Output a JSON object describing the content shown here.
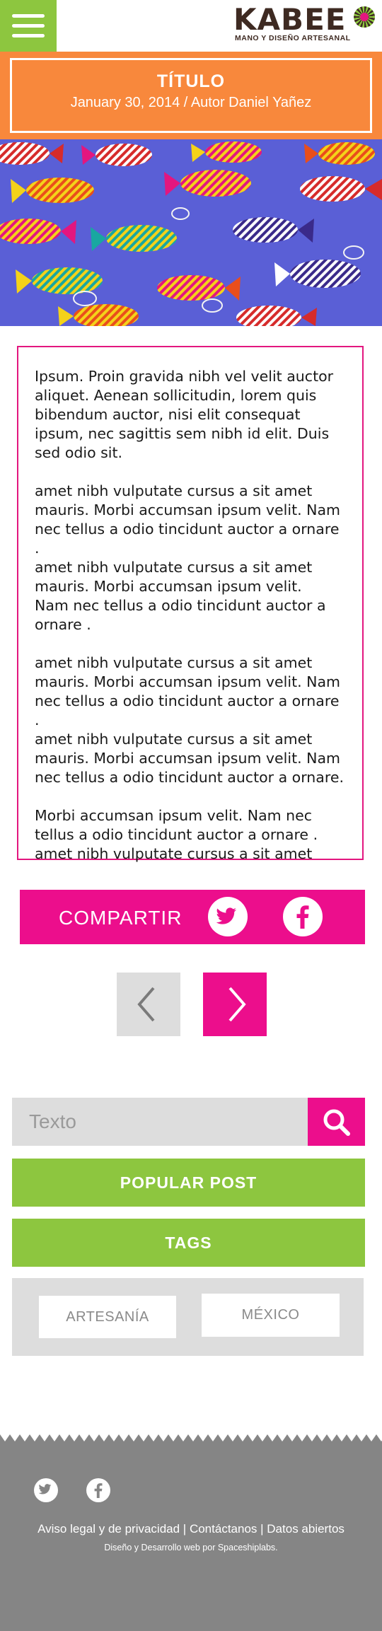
{
  "header": {
    "logo_text": "KABEE",
    "logo_tagline": "MANO Y DISEÑO ARTESANAL"
  },
  "post": {
    "title": "TÍTULO",
    "date": "January 30, 2014",
    "author": " / Autor Daniel Yañez",
    "paragraphs": [
      "Ipsum. Proin gravida nibh vel velit auctor aliquet. Aenean sollicitudin, lorem quis bibendum auctor, nisi elit consequat ipsum, nec sagittis sem nibh id elit. Duis sed odio sit.",
      " amet nibh vulputate cursus a sit amet mauris. Morbi accumsan ipsum velit. Nam nec tellus a odio tincidunt auctor a ornare .\n amet nibh vulputate cursus a sit amet mauris. Morbi accumsan ipsum velit.\nNam nec tellus a odio tincidunt auctor a ornare .",
      " amet nibh vulputate cursus a sit amet mauris. Morbi accumsan ipsum velit. Nam nec tellus a odio tincidunt auctor a ornare .\n amet nibh vulputate cursus a sit amet mauris. Morbi accumsan ipsum velit. Nam nec tellus a odio tincidunt auctor a ornare.",
      "Morbi accumsan ipsum velit. Nam nec tellus a odio tincidunt auctor a ornare .\n amet nibh vulputate cursus a sit amet"
    ]
  },
  "share": {
    "label": "COMPARTIR",
    "icons": [
      "twitter-icon",
      "facebook-icon"
    ]
  },
  "pager": {
    "prev_icon": "chevron-left-icon",
    "next_icon": "chevron-right-icon"
  },
  "sidebar": {
    "search_placeholder": "Texto",
    "search_icon": "search-icon",
    "popular_label": "POPULAR POST",
    "tags_label": "TAGS",
    "tags": [
      "ARTESANÍA",
      "MÉXICO"
    ]
  },
  "footer": {
    "links": [
      "Aviso legal y de privacidad",
      "Contáctanos",
      "Datos abiertos"
    ],
    "separator": " | ",
    "credit": "Diseño y Desarrollo web por Spaceshiplabs."
  },
  "colors": {
    "brand_green": "#8dc63f",
    "brand_orange": "#f8883c",
    "brand_pink": "#ec0e8c",
    "footer_gray": "#858585",
    "panel_gray": "#dddddd"
  }
}
